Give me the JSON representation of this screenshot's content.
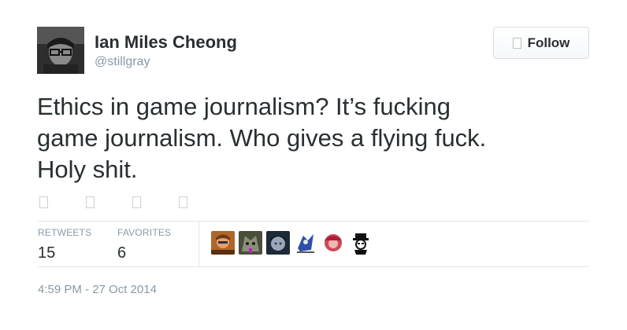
{
  "author": {
    "display_name": "Ian Miles Cheong",
    "screen_name": "@stillgray"
  },
  "follow_button": {
    "label": "Follow",
    "icon": "follow-icon"
  },
  "tweet": {
    "text": "Ethics in game journalism? It’s fucking\ngame journalism. Who gives a flying fuck.\nHoly shit."
  },
  "actions": [
    "reply-icon",
    "retweet-icon",
    "favorite-icon",
    "more-icon"
  ],
  "stats": {
    "retweets_label": "RETWEETS",
    "retweets_value": "15",
    "favorites_label": "FAVORITES",
    "favorites_value": "6"
  },
  "favoriters": [
    {
      "icon": "favoriter-avatar-1"
    },
    {
      "icon": "favoriter-avatar-2"
    },
    {
      "icon": "favoriter-avatar-3"
    },
    {
      "icon": "favoriter-avatar-4"
    },
    {
      "icon": "favoriter-avatar-5"
    },
    {
      "icon": "favoriter-avatar-6"
    }
  ],
  "timestamp": "4:59 PM - 27 Oct 2014",
  "colors": {
    "text": "#292f33",
    "muted": "#8899a6",
    "divider": "#e1e8ed"
  }
}
